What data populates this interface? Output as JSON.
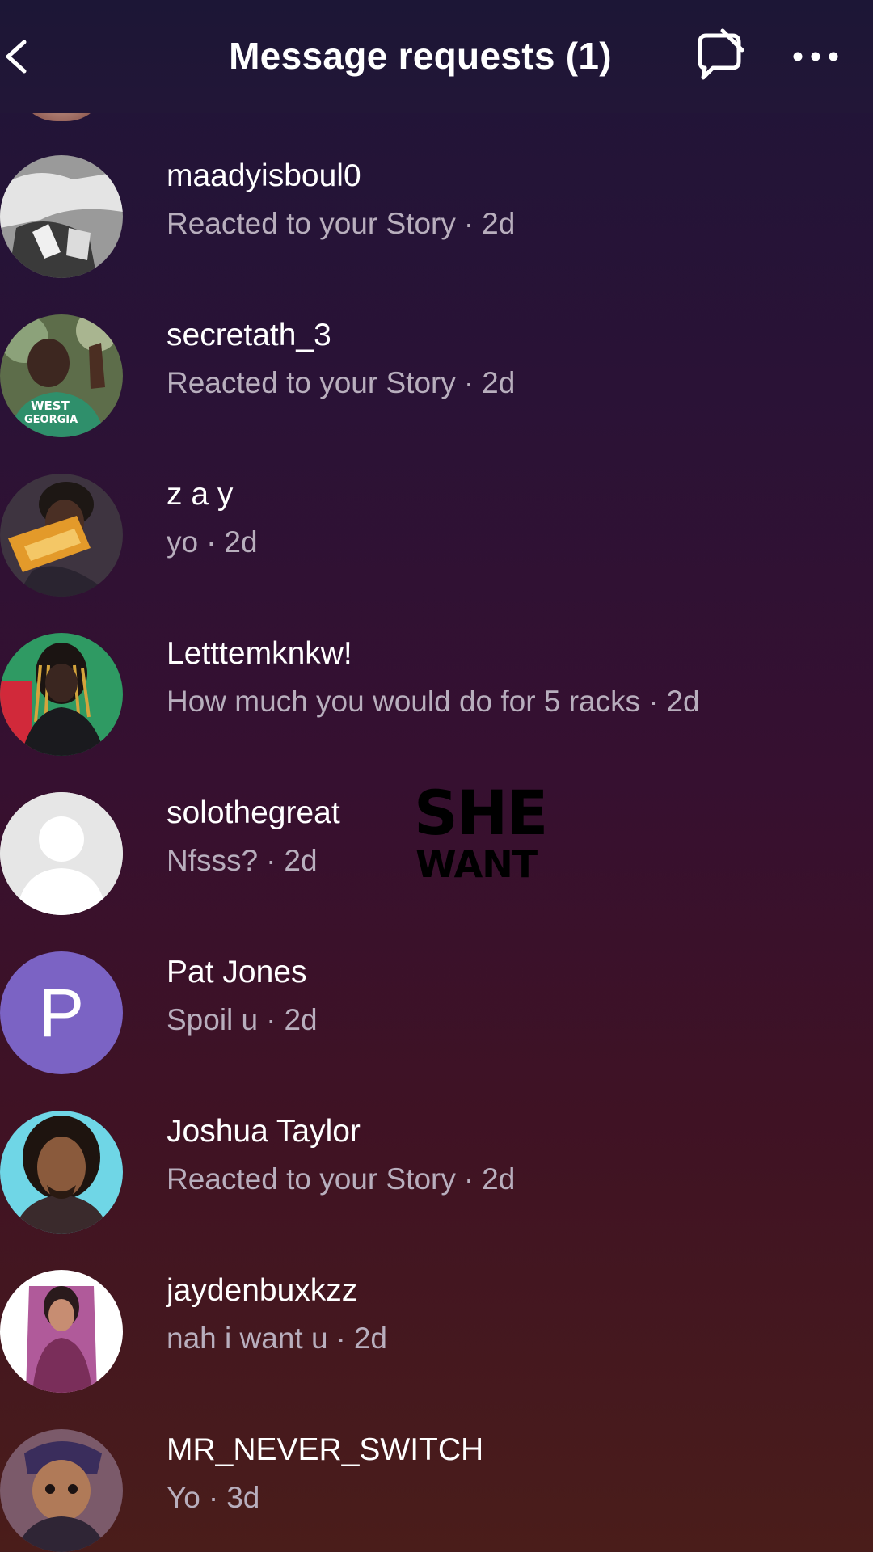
{
  "header": {
    "title": "Message requests (1)",
    "back_icon": "chevron-left-icon",
    "mute_icon": "chat-muted-icon",
    "more_icon": "more-horizontal-icon"
  },
  "requests": [
    {
      "name": "maadyisboul0",
      "message": "Reacted to your Story",
      "time": "2d",
      "avatar": "photo"
    },
    {
      "name": "secretath_3",
      "message": "Reacted to your Story",
      "time": "2d",
      "avatar": "photo"
    },
    {
      "name": "z a y",
      "message": "yo",
      "time": "2d",
      "avatar": "photo"
    },
    {
      "name": "Letttemknkw!",
      "message": "How much you would do for 5 racks",
      "time": "2d",
      "avatar": "photo"
    },
    {
      "name": "solothegreat",
      "message": "Nfsss?",
      "time": "2d",
      "avatar": "default"
    },
    {
      "name": "Pat Jones",
      "message": "Spoil u",
      "time": "2d",
      "avatar": "P"
    },
    {
      "name": "Joshua Taylor",
      "message": "Reacted to your Story",
      "time": "2d",
      "avatar": "photo"
    },
    {
      "name": "jaydenbuxkzz",
      "message": "nah i want u",
      "time": "2d",
      "avatar": "photo"
    },
    {
      "name": "MR_NEVER_SWITCH",
      "message": "Yo",
      "time": "3d",
      "avatar": "photo"
    }
  ],
  "overlay": {
    "line1": "SHE",
    "line2": "WANT"
  },
  "separator": "·",
  "colors": {
    "accent_avatar": "#7b63c4",
    "subtext": "#b8aebd"
  }
}
